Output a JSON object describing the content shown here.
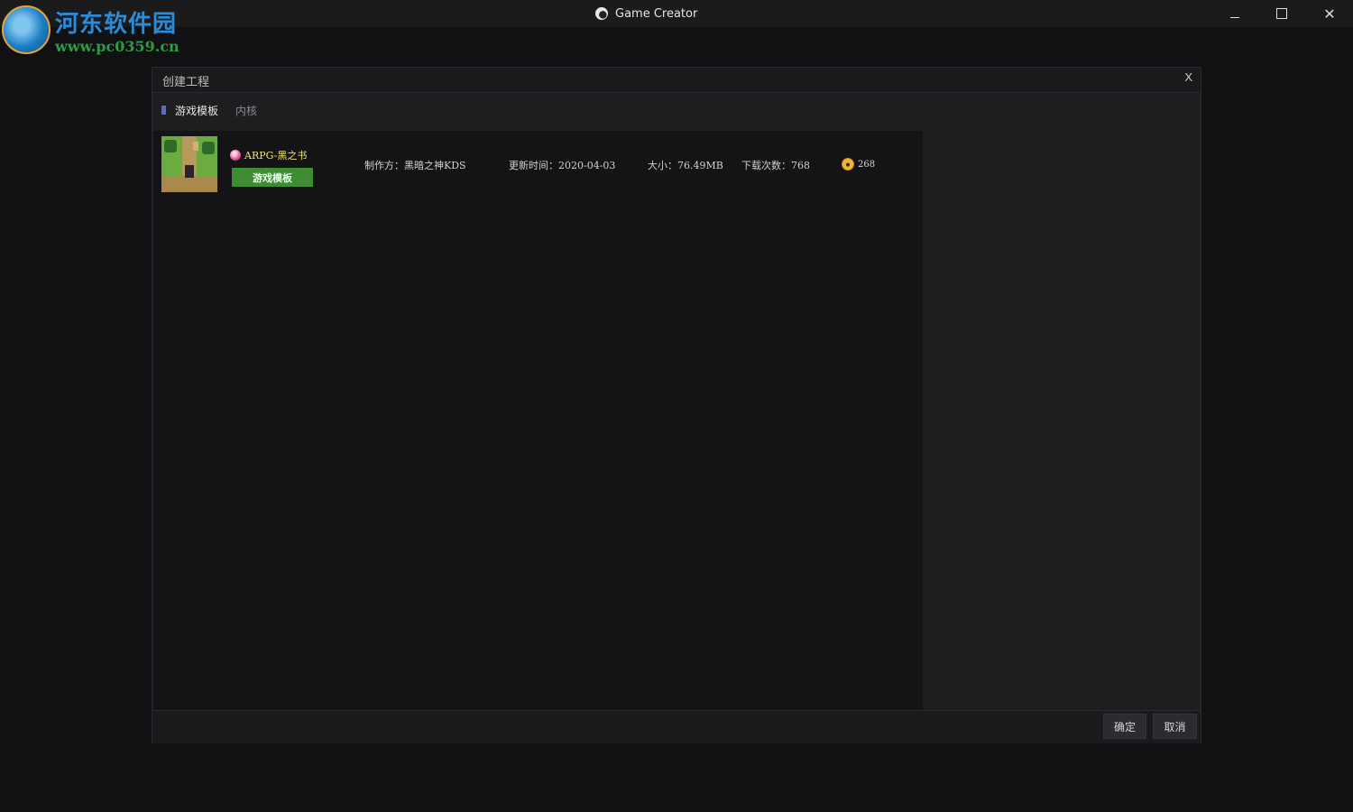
{
  "window": {
    "title": "Game Creator",
    "controls": {
      "minimize": "minimize",
      "maximize": "maximize",
      "close": "✕"
    }
  },
  "watermark": {
    "site_name": "河东软件园",
    "url": "www.pc0359.cn"
  },
  "dialog": {
    "title": "创建工程",
    "close_label": "X",
    "tabs": [
      {
        "label": "游戏模板",
        "active": true
      },
      {
        "label": "内核",
        "active": false
      }
    ],
    "items": [
      {
        "name": "ARPG-黑之书",
        "tag": "游戏模板",
        "author": "制作方：黑暗之神KDS",
        "updated": "更新时间：2020-04-03",
        "size": "大小：76.49MB",
        "downloads": "下载次数：768",
        "coins": "268"
      }
    ],
    "buttons": {
      "ok": "确定",
      "cancel": "取消"
    }
  },
  "colors": {
    "accent_tab_marker": "#5b6ad0",
    "tag_green": "#3f8b34",
    "item_name_yellow": "#f1e56a"
  }
}
